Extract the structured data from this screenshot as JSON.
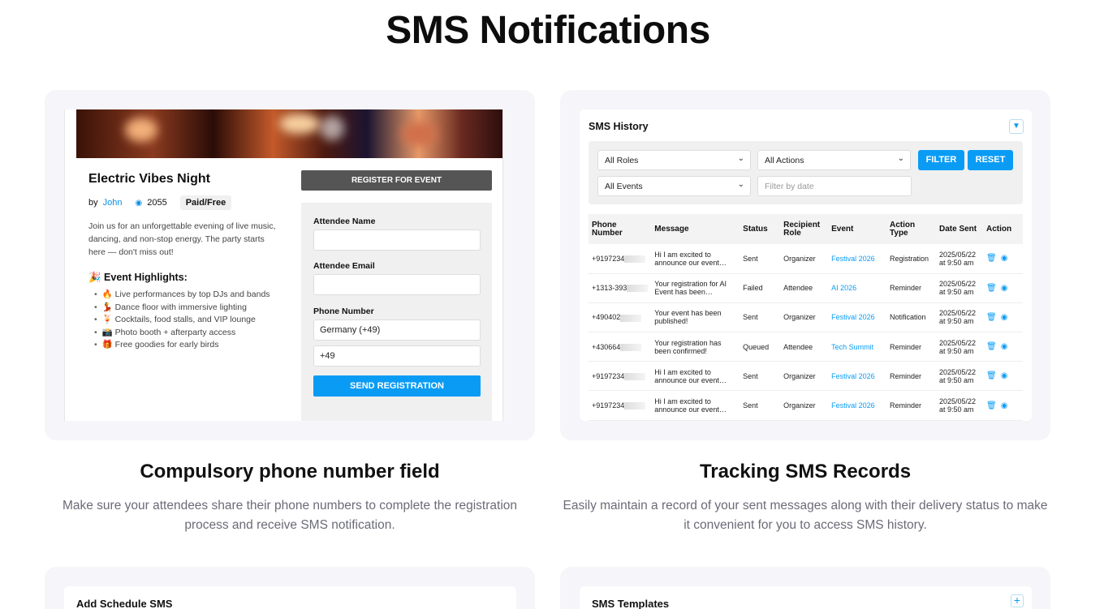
{
  "page": {
    "title": "SMS Notifications"
  },
  "features": [
    {
      "title": "Compulsory phone number field",
      "description": "Make sure your attendees share their phone numbers to complete the registration process and receive SMS notification."
    },
    {
      "title": "Tracking SMS Records",
      "description": "Easily maintain a record of your sent messages along with their delivery status to make it convenient for you to access SMS history."
    }
  ],
  "event": {
    "title": "Electric Vibes Night",
    "by_label": "by",
    "author": "John",
    "views": "2055",
    "price_badge": "Paid/Free",
    "description": "Join us for an unforgettable evening of live music, dancing, and non-stop energy. The party starts here — don't miss out!",
    "highlights_title": "🎉 Event Highlights:",
    "highlights": [
      "🔥 Live performances by top DJs and bands",
      "💃 Dance floor with immersive lighting",
      "🍹 Cocktails, food stalls, and VIP lounge",
      "📸 Photo booth + afterparty access",
      "🎁 Free goodies for early birds"
    ],
    "register_button": "REGISTER FOR EVENT",
    "form": {
      "name_label": "Attendee Name",
      "name_value": "",
      "email_label": "Attendee Email",
      "email_value": "",
      "phone_label": "Phone Number",
      "country_value": "Germany (+49)",
      "phone_value": "+49",
      "submit_label": "SEND REGISTRATION"
    }
  },
  "sms_history": {
    "title": "SMS History",
    "filters": {
      "roles": "All Roles",
      "actions": "All Actions",
      "events": "All Events",
      "date_placeholder": "Filter by date",
      "filter_button": "FILTER",
      "reset_button": "RESET"
    },
    "columns": [
      "Phone Number",
      "Message",
      "Status",
      "Recipient Role",
      "Event",
      "Action Type",
      "Date Sent",
      "Action"
    ],
    "rows": [
      {
        "phone": "+9197234",
        "message": "Hi I am excited to announce our event…",
        "status": "Sent",
        "role": "Organizer",
        "event": "Festival 2026",
        "action_type": "Registration",
        "date": "2025/05/22 at 9:50 am"
      },
      {
        "phone": "+1313-393",
        "message": "Your registration for AI Event has been…",
        "status": "Failed",
        "role": "Attendee",
        "event": "AI 2026",
        "action_type": "Reminder",
        "date": "2025/05/22 at 9:50 am"
      },
      {
        "phone": "+490402",
        "message": "Your event has been published!",
        "status": "Sent",
        "role": "Organizer",
        "event": "Festival 2026",
        "action_type": "Notification",
        "date": "2025/05/22 at 9:50 am"
      },
      {
        "phone": "+430664",
        "message": "Your registration has been confirmed!",
        "status": "Queued",
        "role": "Attendee",
        "event": "Tech Summit",
        "action_type": "Reminder",
        "date": "2025/05/22 at 9:50 am"
      },
      {
        "phone": "+9197234",
        "message": "Hi I am excited to announce our event…",
        "status": "Sent",
        "role": "Organizer",
        "event": "Festival 2026",
        "action_type": "Reminder",
        "date": "2025/05/22 at 9:50 am"
      },
      {
        "phone": "+9197234",
        "message": "Hi I am excited to announce our event…",
        "status": "Sent",
        "role": "Organizer",
        "event": "Festival 2026",
        "action_type": "Reminder",
        "date": "2025/05/22 at 9:50 am"
      }
    ]
  },
  "bottom_cards": {
    "left_title": "Add Schedule SMS",
    "right_title": "SMS Templates"
  },
  "colors": {
    "accent": "#0a9cf5",
    "panel_bg": "#f5f5fa",
    "dark_button": "#555555"
  },
  "icons": {
    "views": "eye-icon",
    "filter": "filter-icon",
    "delete": "trash-icon",
    "view": "eye-icon",
    "add": "plus-icon"
  }
}
